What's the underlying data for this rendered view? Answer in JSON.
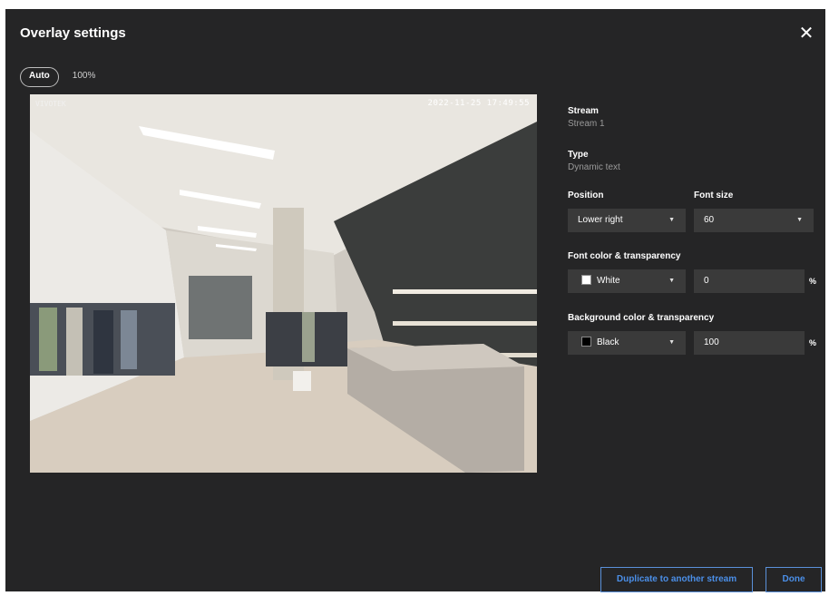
{
  "dialog": {
    "title": "Overlay settings"
  },
  "zoom": {
    "tabs": [
      {
        "label": "Auto"
      },
      {
        "label": "100%"
      }
    ]
  },
  "preview": {
    "camera_name": "VIVOTEK",
    "timestamp": "2022-11-25 17:49:55"
  },
  "settings": {
    "stream_label": "Stream",
    "stream_value": "Stream 1",
    "type_label": "Type",
    "type_value": "Dynamic text",
    "position_label": "Position",
    "position_value": "Lower right",
    "font_size_label": "Font size",
    "font_size_value": "60",
    "font_color_label": "Font color & transparency",
    "font_color_value": "White",
    "font_color_swatch": "#ffffff",
    "font_transparency_value": "0",
    "bg_color_label": "Background color & transparency",
    "bg_color_value": "Black",
    "bg_color_swatch": "#000000",
    "bg_transparency_value": "100",
    "percent_unit": "%"
  },
  "footer": {
    "duplicate_label": "Duplicate to another stream",
    "done_label": "Done"
  }
}
